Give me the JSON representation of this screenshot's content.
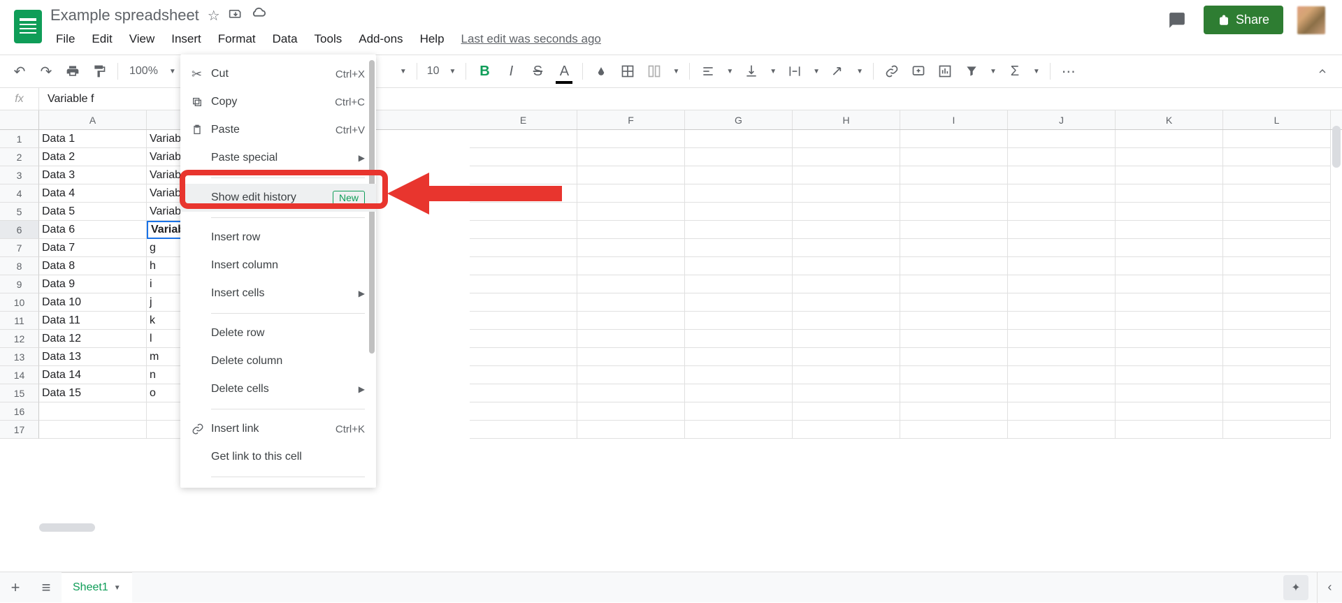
{
  "doc_title": "Example spreadsheet",
  "menus": [
    "File",
    "Edit",
    "View",
    "Insert",
    "Format",
    "Data",
    "Tools",
    "Add-ons",
    "Help"
  ],
  "last_edit": "Last edit was seconds ago",
  "share_label": "Share",
  "toolbar": {
    "zoom": "100%",
    "font_size": "10"
  },
  "formula_bar_value": "Variable f",
  "columns": [
    "A",
    "B",
    "",
    "",
    "E",
    "F",
    "G",
    "H",
    "I",
    "J",
    "K",
    "L"
  ],
  "rows": [
    {
      "n": "1",
      "a": "Data 1",
      "b": "Variable a"
    },
    {
      "n": "2",
      "a": "Data 2",
      "b": "Variable b"
    },
    {
      "n": "3",
      "a": "Data 3",
      "b": "Variable c"
    },
    {
      "n": "4",
      "a": "Data 4",
      "b": "Variable d"
    },
    {
      "n": "5",
      "a": "Data 5",
      "b": "Variable e"
    },
    {
      "n": "6",
      "a": "Data 6",
      "b": "Variable f",
      "selected": true
    },
    {
      "n": "7",
      "a": "Data 7",
      "b": "g"
    },
    {
      "n": "8",
      "a": "Data 8",
      "b": "h"
    },
    {
      "n": "9",
      "a": "Data 9",
      "b": "i"
    },
    {
      "n": "10",
      "a": "Data 10",
      "b": "j"
    },
    {
      "n": "11",
      "a": "Data 11",
      "b": "k"
    },
    {
      "n": "12",
      "a": "Data 12",
      "b": "l"
    },
    {
      "n": "13",
      "a": "Data 13",
      "b": "m"
    },
    {
      "n": "14",
      "a": "Data 14",
      "b": "n"
    },
    {
      "n": "15",
      "a": "Data 15",
      "b": "o"
    },
    {
      "n": "16",
      "a": "",
      "b": ""
    },
    {
      "n": "17",
      "a": "",
      "b": ""
    }
  ],
  "context_menu": {
    "cut": {
      "label": "Cut",
      "shortcut": "Ctrl+X"
    },
    "copy": {
      "label": "Copy",
      "shortcut": "Ctrl+C"
    },
    "paste": {
      "label": "Paste",
      "shortcut": "Ctrl+V"
    },
    "paste_special": {
      "label": "Paste special"
    },
    "show_edit_history": {
      "label": "Show edit history",
      "badge": "New"
    },
    "insert_row": {
      "label": "Insert row"
    },
    "insert_column": {
      "label": "Insert column"
    },
    "insert_cells": {
      "label": "Insert cells"
    },
    "delete_row": {
      "label": "Delete row"
    },
    "delete_column": {
      "label": "Delete column"
    },
    "delete_cells": {
      "label": "Delete cells"
    },
    "insert_link": {
      "label": "Insert link",
      "shortcut": "Ctrl+K"
    },
    "get_link": {
      "label": "Get link to this cell"
    }
  },
  "sheet_tab": "Sheet1"
}
